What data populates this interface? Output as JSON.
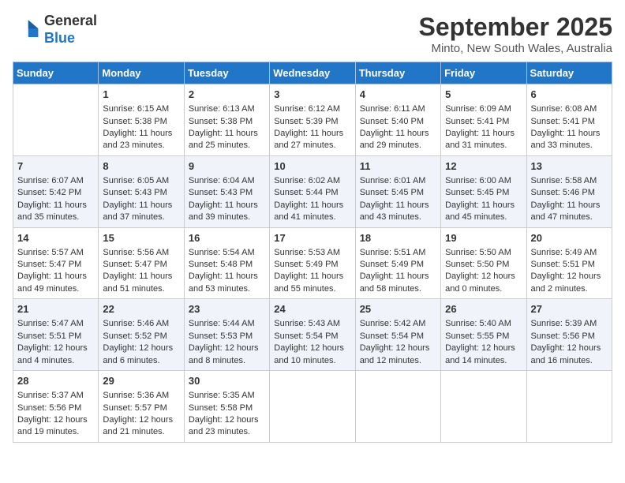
{
  "logo": {
    "line1": "General",
    "line2": "Blue"
  },
  "title": "September 2025",
  "location": "Minto, New South Wales, Australia",
  "days_header": [
    "Sunday",
    "Monday",
    "Tuesday",
    "Wednesday",
    "Thursday",
    "Friday",
    "Saturday"
  ],
  "weeks": [
    [
      {
        "day": "",
        "sunrise": "",
        "sunset": "",
        "daylight": ""
      },
      {
        "day": "1",
        "sunrise": "Sunrise: 6:15 AM",
        "sunset": "Sunset: 5:38 PM",
        "daylight": "Daylight: 11 hours and 23 minutes."
      },
      {
        "day": "2",
        "sunrise": "Sunrise: 6:13 AM",
        "sunset": "Sunset: 5:38 PM",
        "daylight": "Daylight: 11 hours and 25 minutes."
      },
      {
        "day": "3",
        "sunrise": "Sunrise: 6:12 AM",
        "sunset": "Sunset: 5:39 PM",
        "daylight": "Daylight: 11 hours and 27 minutes."
      },
      {
        "day": "4",
        "sunrise": "Sunrise: 6:11 AM",
        "sunset": "Sunset: 5:40 PM",
        "daylight": "Daylight: 11 hours and 29 minutes."
      },
      {
        "day": "5",
        "sunrise": "Sunrise: 6:09 AM",
        "sunset": "Sunset: 5:41 PM",
        "daylight": "Daylight: 11 hours and 31 minutes."
      },
      {
        "day": "6",
        "sunrise": "Sunrise: 6:08 AM",
        "sunset": "Sunset: 5:41 PM",
        "daylight": "Daylight: 11 hours and 33 minutes."
      }
    ],
    [
      {
        "day": "7",
        "sunrise": "Sunrise: 6:07 AM",
        "sunset": "Sunset: 5:42 PM",
        "daylight": "Daylight: 11 hours and 35 minutes."
      },
      {
        "day": "8",
        "sunrise": "Sunrise: 6:05 AM",
        "sunset": "Sunset: 5:43 PM",
        "daylight": "Daylight: 11 hours and 37 minutes."
      },
      {
        "day": "9",
        "sunrise": "Sunrise: 6:04 AM",
        "sunset": "Sunset: 5:43 PM",
        "daylight": "Daylight: 11 hours and 39 minutes."
      },
      {
        "day": "10",
        "sunrise": "Sunrise: 6:02 AM",
        "sunset": "Sunset: 5:44 PM",
        "daylight": "Daylight: 11 hours and 41 minutes."
      },
      {
        "day": "11",
        "sunrise": "Sunrise: 6:01 AM",
        "sunset": "Sunset: 5:45 PM",
        "daylight": "Daylight: 11 hours and 43 minutes."
      },
      {
        "day": "12",
        "sunrise": "Sunrise: 6:00 AM",
        "sunset": "Sunset: 5:45 PM",
        "daylight": "Daylight: 11 hours and 45 minutes."
      },
      {
        "day": "13",
        "sunrise": "Sunrise: 5:58 AM",
        "sunset": "Sunset: 5:46 PM",
        "daylight": "Daylight: 11 hours and 47 minutes."
      }
    ],
    [
      {
        "day": "14",
        "sunrise": "Sunrise: 5:57 AM",
        "sunset": "Sunset: 5:47 PM",
        "daylight": "Daylight: 11 hours and 49 minutes."
      },
      {
        "day": "15",
        "sunrise": "Sunrise: 5:56 AM",
        "sunset": "Sunset: 5:47 PM",
        "daylight": "Daylight: 11 hours and 51 minutes."
      },
      {
        "day": "16",
        "sunrise": "Sunrise: 5:54 AM",
        "sunset": "Sunset: 5:48 PM",
        "daylight": "Daylight: 11 hours and 53 minutes."
      },
      {
        "day": "17",
        "sunrise": "Sunrise: 5:53 AM",
        "sunset": "Sunset: 5:49 PM",
        "daylight": "Daylight: 11 hours and 55 minutes."
      },
      {
        "day": "18",
        "sunrise": "Sunrise: 5:51 AM",
        "sunset": "Sunset: 5:49 PM",
        "daylight": "Daylight: 11 hours and 58 minutes."
      },
      {
        "day": "19",
        "sunrise": "Sunrise: 5:50 AM",
        "sunset": "Sunset: 5:50 PM",
        "daylight": "Daylight: 12 hours and 0 minutes."
      },
      {
        "day": "20",
        "sunrise": "Sunrise: 5:49 AM",
        "sunset": "Sunset: 5:51 PM",
        "daylight": "Daylight: 12 hours and 2 minutes."
      }
    ],
    [
      {
        "day": "21",
        "sunrise": "Sunrise: 5:47 AM",
        "sunset": "Sunset: 5:51 PM",
        "daylight": "Daylight: 12 hours and 4 minutes."
      },
      {
        "day": "22",
        "sunrise": "Sunrise: 5:46 AM",
        "sunset": "Sunset: 5:52 PM",
        "daylight": "Daylight: 12 hours and 6 minutes."
      },
      {
        "day": "23",
        "sunrise": "Sunrise: 5:44 AM",
        "sunset": "Sunset: 5:53 PM",
        "daylight": "Daylight: 12 hours and 8 minutes."
      },
      {
        "day": "24",
        "sunrise": "Sunrise: 5:43 AM",
        "sunset": "Sunset: 5:54 PM",
        "daylight": "Daylight: 12 hours and 10 minutes."
      },
      {
        "day": "25",
        "sunrise": "Sunrise: 5:42 AM",
        "sunset": "Sunset: 5:54 PM",
        "daylight": "Daylight: 12 hours and 12 minutes."
      },
      {
        "day": "26",
        "sunrise": "Sunrise: 5:40 AM",
        "sunset": "Sunset: 5:55 PM",
        "daylight": "Daylight: 12 hours and 14 minutes."
      },
      {
        "day": "27",
        "sunrise": "Sunrise: 5:39 AM",
        "sunset": "Sunset: 5:56 PM",
        "daylight": "Daylight: 12 hours and 16 minutes."
      }
    ],
    [
      {
        "day": "28",
        "sunrise": "Sunrise: 5:37 AM",
        "sunset": "Sunset: 5:56 PM",
        "daylight": "Daylight: 12 hours and 19 minutes."
      },
      {
        "day": "29",
        "sunrise": "Sunrise: 5:36 AM",
        "sunset": "Sunset: 5:57 PM",
        "daylight": "Daylight: 12 hours and 21 minutes."
      },
      {
        "day": "30",
        "sunrise": "Sunrise: 5:35 AM",
        "sunset": "Sunset: 5:58 PM",
        "daylight": "Daylight: 12 hours and 23 minutes."
      },
      {
        "day": "",
        "sunrise": "",
        "sunset": "",
        "daylight": ""
      },
      {
        "day": "",
        "sunrise": "",
        "sunset": "",
        "daylight": ""
      },
      {
        "day": "",
        "sunrise": "",
        "sunset": "",
        "daylight": ""
      },
      {
        "day": "",
        "sunrise": "",
        "sunset": "",
        "daylight": ""
      }
    ]
  ]
}
